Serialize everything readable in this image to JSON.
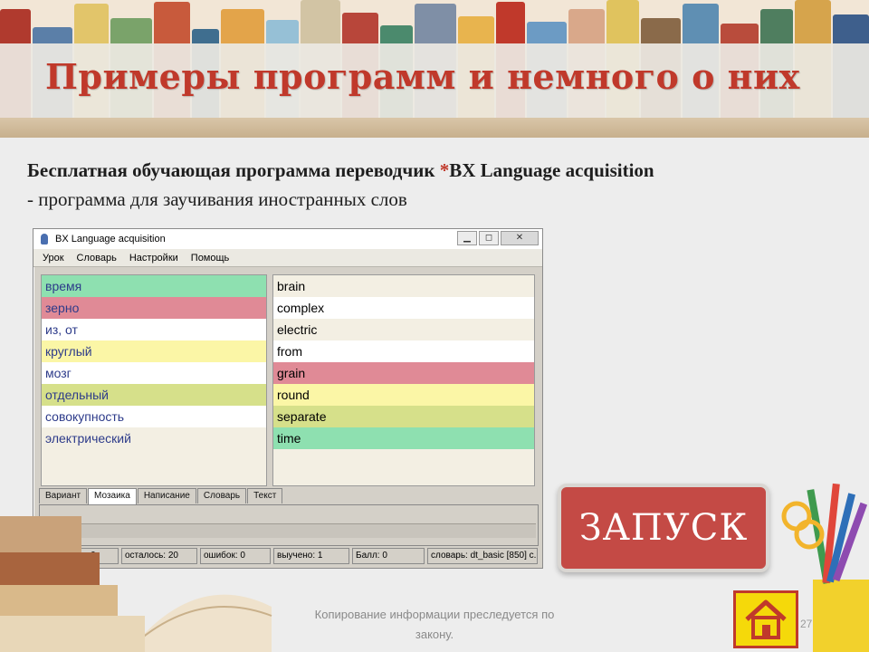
{
  "slide": {
    "title": "Примеры программ и немного о них",
    "subtitle_line1_prefix": "Бесплатная обучающая программа переводчик ",
    "subtitle_star": "*",
    "subtitle_line1_suffix": "BX Language acquisition",
    "subtitle_line2": "- программа для заучивания иностранных слов",
    "launch_label": "ЗАПУСК",
    "footer_note": "Копирование информации преследуется по закону.",
    "page_number": "27"
  },
  "app": {
    "window_title": "BX Language acquisition",
    "window_buttons": [
      "▁",
      "◻",
      "✕"
    ],
    "menu": [
      "Урок",
      "Словарь",
      "Настройки",
      "Помощь"
    ],
    "left_words": [
      {
        "text": "время",
        "color": "#8ee0b0"
      },
      {
        "text": "зерно",
        "color": "#e08a96"
      },
      {
        "text": "из, от",
        "color": "#ffffff"
      },
      {
        "text": "круглый",
        "color": "#fbf6a6"
      },
      {
        "text": "мозг",
        "color": "#ffffff"
      },
      {
        "text": "отдельный",
        "color": "#d6e08a"
      },
      {
        "text": "совокупность",
        "color": "#ffffff"
      },
      {
        "text": "электрический",
        "color": "#f3efe3"
      }
    ],
    "right_words": [
      {
        "text": "brain",
        "color": "#f3efe3"
      },
      {
        "text": "complex",
        "color": "#ffffff"
      },
      {
        "text": "electric",
        "color": "#f3efe3"
      },
      {
        "text": "from",
        "color": "#ffffff"
      },
      {
        "text": "grain",
        "color": "#e08a96"
      },
      {
        "text": "round",
        "color": "#fbf6a6"
      },
      {
        "text": "separate",
        "color": "#d6e08a"
      },
      {
        "text": "time",
        "color": "#8ee0b0"
      }
    ],
    "tabs": [
      "Вариант",
      "Мозаика",
      "Написание",
      "Словарь",
      "Текст"
    ],
    "active_tab": "Мозаика",
    "status": [
      "правильно: 0",
      "осталось: 20",
      "ошибок: 0",
      "выучено: 1",
      "Балл: 0",
      "словарь: dt_basic [850] с."
    ]
  }
}
